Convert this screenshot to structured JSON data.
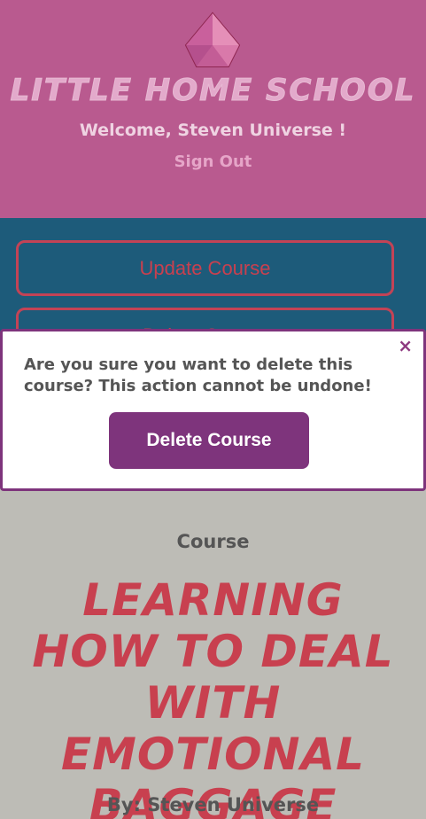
{
  "header": {
    "logo_text": "Little Home School",
    "welcome": "Welcome, Steven Universe !",
    "sign_out": "Sign Out"
  },
  "actions": {
    "update_label": "Update Course",
    "delete_label": "Delete Course"
  },
  "modal": {
    "close": "×",
    "message": "Are you sure you want to delete this course? This action cannot be undone!",
    "confirm_label": "Delete Course"
  },
  "course": {
    "label": "Course",
    "title": "Learning How to Deal With Emotional Baggage",
    "author": "By: Steven Universe"
  },
  "colors": {
    "header_bg": "#b95a8f",
    "actions_bg": "#1d5b7a",
    "accent_red": "#c8404f",
    "modal_purple": "#7e347c",
    "page_bg": "#bdbcb6"
  }
}
